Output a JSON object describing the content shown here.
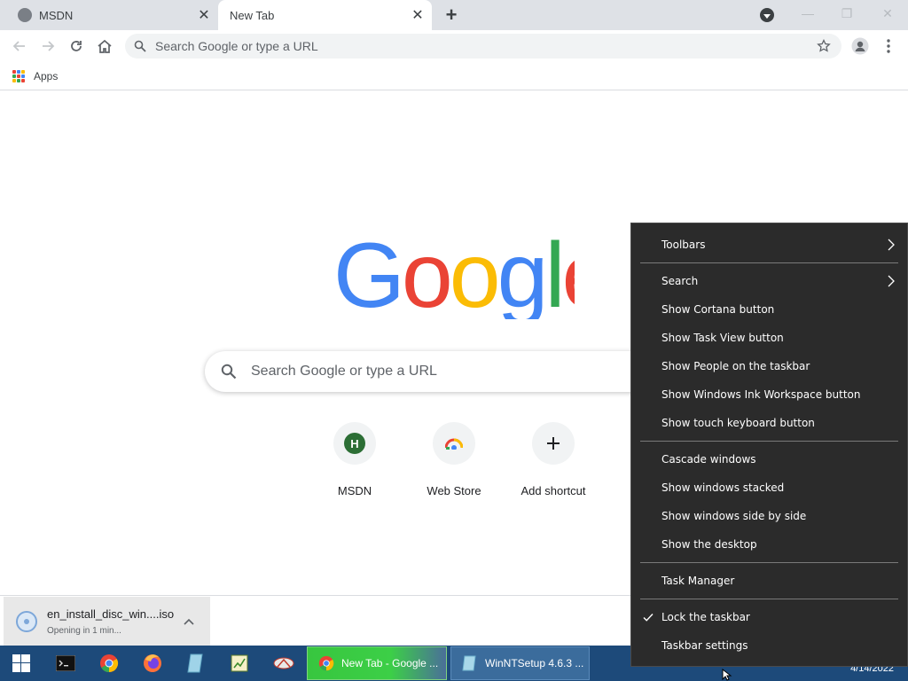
{
  "tabs": [
    {
      "label": "MSDN",
      "active": false
    },
    {
      "label": "New Tab",
      "active": true
    }
  ],
  "omnibox": {
    "placeholder": "Search Google or type a URL"
  },
  "bookmarks": {
    "apps_label": "Apps"
  },
  "ntp": {
    "logo_text": "Google",
    "search_placeholder": "Search Google or type a URL",
    "shortcuts": [
      {
        "title": "MSDN",
        "badge": "H"
      },
      {
        "title": "Web Store"
      },
      {
        "title": "Add shortcut"
      }
    ]
  },
  "download": {
    "filename": "en_install_disc_win....iso",
    "status": "Opening in 1 min..."
  },
  "taskbar": {
    "apps": [
      {
        "label": "New Tab - Google ..."
      },
      {
        "label": "WinNTSetup 4.6.3  ..."
      }
    ],
    "clock_date": "4/14/2022"
  },
  "context_menu": {
    "items": [
      {
        "label": "Toolbars",
        "submenu": true
      },
      {
        "label": "Search",
        "submenu": true
      },
      {
        "label": "Show Cortana button"
      },
      {
        "label": "Show Task View button"
      },
      {
        "label": "Show People on the taskbar"
      },
      {
        "label": "Show Windows Ink Workspace button"
      },
      {
        "label": "Show touch keyboard button"
      },
      {
        "label": "Cascade windows"
      },
      {
        "label": "Show windows stacked"
      },
      {
        "label": "Show windows side by side"
      },
      {
        "label": "Show the desktop"
      },
      {
        "label": "Task Manager"
      },
      {
        "label": "Lock the taskbar",
        "checked": true
      },
      {
        "label": "Taskbar settings"
      }
    ]
  },
  "colors": {
    "google_blue": "#4285f4",
    "google_red": "#ea4335",
    "google_yellow": "#fbbc05",
    "google_green": "#34a853",
    "taskbar": "#1d4a7a",
    "menu_bg": "#2b2b2b"
  }
}
